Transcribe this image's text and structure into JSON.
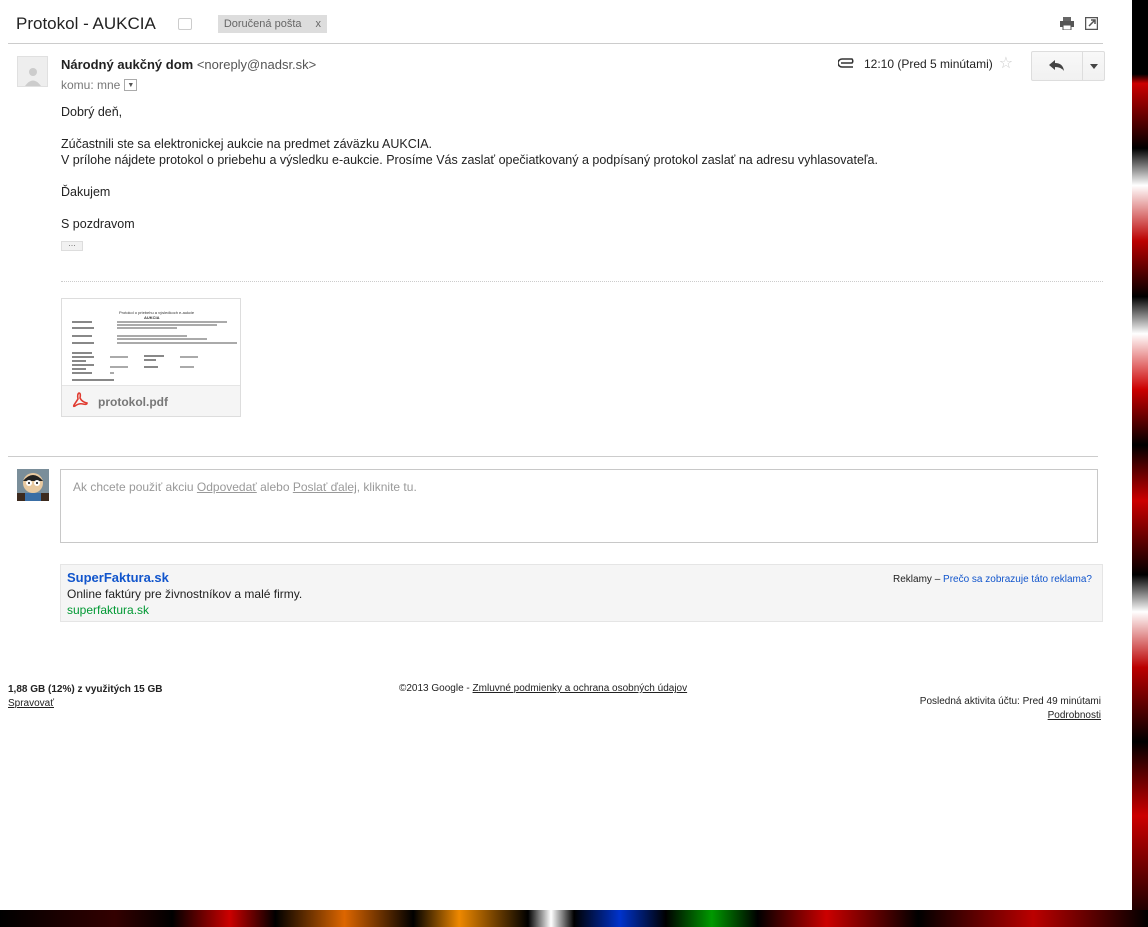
{
  "subject": {
    "title": "Protokol - AUKCIA",
    "label": "Doručená pošta",
    "label_close": "x"
  },
  "toolbar": {
    "icons": [
      "print-icon",
      "new-window-icon"
    ]
  },
  "message": {
    "sender_name": "Národný aukčný dom",
    "sender_email": "<noreply@nadsr.sk>",
    "to_label": "komu: mne",
    "time": "12:10 (Pred 5 minútami)",
    "greeting": "Dobrý deň,",
    "para1_line1": "Zúčastnili ste sa elektronickej aukcie na predmet záväzku AUKCIA.",
    "para1_line2": "V prílohe nájdete protokol o priebehu a výsledku e-aukcie. Prosíme Vás zaslať opečiatkovaný a podpísaný protokol zaslať na adresu vyhlasovateľa.",
    "thanks": "Ďakujem",
    "signoff": "S pozdravom",
    "ellipsis": "..."
  },
  "attachment": {
    "filename": "protokol.pdf",
    "doc_title": "Protokol o priebehu a výsledkoch e-aukcie",
    "doc_subtitle": "AUKCIA"
  },
  "reply_box": {
    "prefix": "Ak chcete použiť akciu ",
    "reply_link": "Odpovedať",
    "middle": " alebo ",
    "forward_link": "Poslať ďalej",
    "suffix": ", kliknite tu."
  },
  "ad": {
    "title": "SuperFaktura.sk",
    "description": "Online faktúry pre živnostníkov a malé firmy.",
    "url": "superfaktura.sk",
    "info_prefix": "Reklamy – ",
    "why_link": "Prečo sa zobrazuje táto reklama?"
  },
  "footer": {
    "storage": "1,88 GB (12%) z využitých 15 GB",
    "manage": "Spravovať",
    "copyright": "©2013 Google - ",
    "terms": "Zmluvné podmienky a ochrana osobných údajov",
    "last_activity": "Posledná aktivita účtu: Pred 49 minútami",
    "details": "Podrobnosti"
  },
  "colors": {
    "link_blue": "#1155cc",
    "ad_green": "#009933",
    "pdf_red": "#e03c31"
  }
}
